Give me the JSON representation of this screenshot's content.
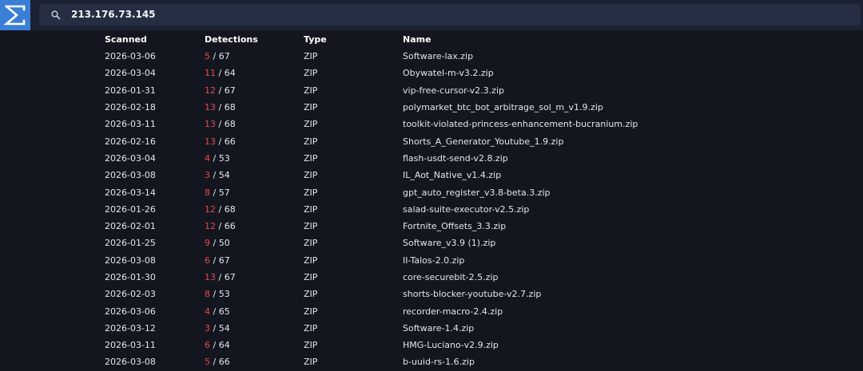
{
  "app": {
    "logo_icon": "sigma-chevron-logo-icon"
  },
  "search": {
    "query": "213.176.73.145",
    "icon": "search-icon"
  },
  "table": {
    "headers": {
      "scanned": "Scanned",
      "detections": "Detections",
      "type": "Type",
      "name": "Name"
    },
    "rows": [
      {
        "scanned": "2026-03-06",
        "positives": "5",
        "total": "/ 67",
        "type": "ZIP",
        "name": "Software-lax.zip"
      },
      {
        "scanned": "2026-03-04",
        "positives": "11",
        "total": "/ 64",
        "type": "ZIP",
        "name": "Obywatel-m-v3.2.zip"
      },
      {
        "scanned": "2026-01-31",
        "positives": "12",
        "total": "/ 67",
        "type": "ZIP",
        "name": "vip-free-cursor-v2.3.zip"
      },
      {
        "scanned": "2026-02-18",
        "positives": "13",
        "total": "/ 68",
        "type": "ZIP",
        "name": "polymarket_btc_bot_arbitrage_sol_m_v1.9.zip"
      },
      {
        "scanned": "2026-03-11",
        "positives": "13",
        "total": "/ 68",
        "type": "ZIP",
        "name": "toolkit-violated-princess-enhancement-bucranium.zip"
      },
      {
        "scanned": "2026-02-16",
        "positives": "13",
        "total": "/ 66",
        "type": "ZIP",
        "name": "Shorts_A_Generator_Youtube_1.9.zip"
      },
      {
        "scanned": "2026-03-04",
        "positives": "4",
        "total": "/ 53",
        "type": "ZIP",
        "name": "flash-usdt-send-v2.8.zip"
      },
      {
        "scanned": "2026-03-08",
        "positives": "3",
        "total": "/ 54",
        "type": "ZIP",
        "name": "IL_Aot_Native_v1.4.zip"
      },
      {
        "scanned": "2026-03-14",
        "positives": "8",
        "total": "/ 57",
        "type": "ZIP",
        "name": "gpt_auto_register_v3.8-beta.3.zip"
      },
      {
        "scanned": "2026-01-26",
        "positives": "12",
        "total": "/ 68",
        "type": "ZIP",
        "name": "salad-suite-executor-v2.5.zip"
      },
      {
        "scanned": "2026-02-01",
        "positives": "12",
        "total": "/ 66",
        "type": "ZIP",
        "name": "Fortnite_Offsets_3.3.zip"
      },
      {
        "scanned": "2026-01-25",
        "positives": "9",
        "total": "/ 50",
        "type": "ZIP",
        "name": "Software_v3.9 (1).zip"
      },
      {
        "scanned": "2026-03-08",
        "positives": "6",
        "total": "/ 67",
        "type": "ZIP",
        "name": "II-Talos-2.0.zip"
      },
      {
        "scanned": "2026-01-30",
        "positives": "13",
        "total": "/ 67",
        "type": "ZIP",
        "name": "core-securebit-2.5.zip"
      },
      {
        "scanned": "2026-02-03",
        "positives": "8",
        "total": "/ 53",
        "type": "ZIP",
        "name": "shorts-blocker-youtube-v2.7.zip"
      },
      {
        "scanned": "2026-03-06",
        "positives": "4",
        "total": "/ 65",
        "type": "ZIP",
        "name": "recorder-macro-2.4.zip"
      },
      {
        "scanned": "2026-03-12",
        "positives": "3",
        "total": "/ 54",
        "type": "ZIP",
        "name": "Software-1.4.zip"
      },
      {
        "scanned": "2026-03-11",
        "positives": "6",
        "total": "/ 64",
        "type": "ZIP",
        "name": "HMG-Luciano-v2.9.zip"
      },
      {
        "scanned": "2026-03-08",
        "positives": "5",
        "total": "/ 66",
        "type": "ZIP",
        "name": "b-uuid-rs-1.6.zip"
      }
    ]
  },
  "colors": {
    "background": "#14161f",
    "header": "#1b2233",
    "search_field": "#252e42",
    "logo": "#3a7fd5",
    "detection_positive": "#e5484d",
    "text": "#e3e6ec"
  }
}
